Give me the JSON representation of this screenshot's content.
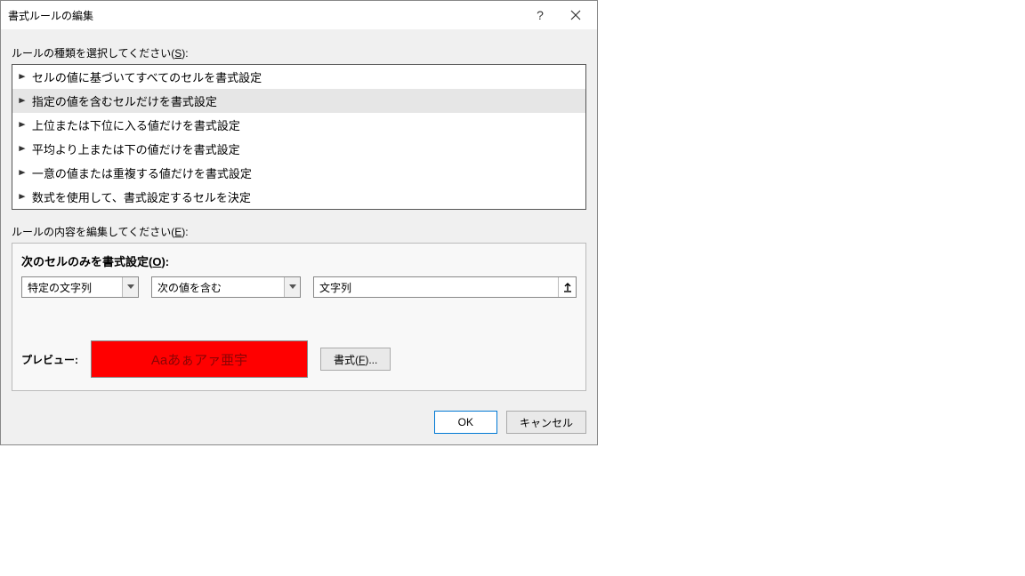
{
  "title": "書式ルールの編集",
  "section_rule_type": {
    "label_prefix": "ルールの種類を選択してください(",
    "accel": "S",
    "label_suffix": "):"
  },
  "rule_types": [
    "セルの値に基づいてすべてのセルを書式設定",
    "指定の値を含むセルだけを書式設定",
    "上位または下位に入る値だけを書式設定",
    "平均より上または下の値だけを書式設定",
    "一意の値または重複する値だけを書式設定",
    "数式を使用して、書式設定するセルを決定"
  ],
  "selected_rule_index": 1,
  "section_rule_content": {
    "label_prefix": "ルールの内容を編集してください(",
    "accel": "E",
    "label_suffix": "):"
  },
  "content": {
    "heading_prefix": "次のセルのみを書式設定(",
    "heading_accel": "O",
    "heading_suffix": "):",
    "combo1": "特定の文字列",
    "combo2": "次の値を含む",
    "ref_value": "文字列",
    "preview_label": "プレビュー:",
    "preview_sample": "Aaあぁアァ亜宇",
    "format_btn_prefix": "書式(",
    "format_btn_accel": "F",
    "format_btn_suffix": ")..."
  },
  "footer": {
    "ok": "OK",
    "cancel": "キャンセル"
  }
}
